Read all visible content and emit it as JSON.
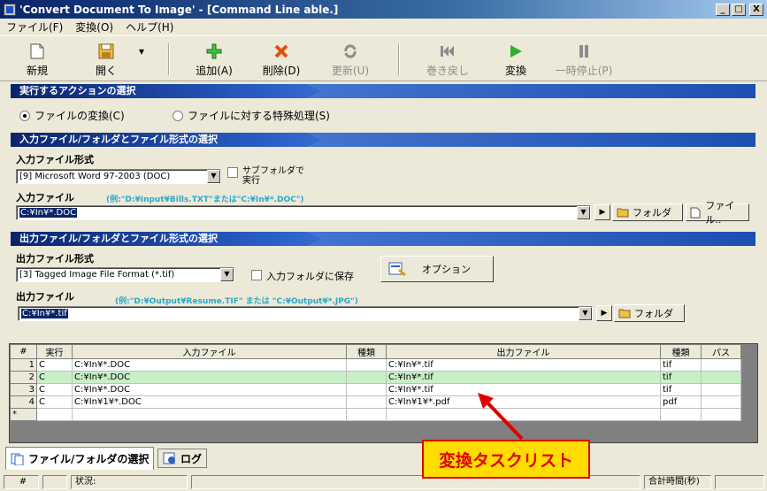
{
  "window": {
    "title": "'Convert Document To Image' - [Command Line able.]",
    "min": "_",
    "max": "□",
    "close": "X"
  },
  "menu": [
    "ファイル(F)",
    "変換(O)",
    "ヘルプ(H)"
  ],
  "toolbar": {
    "new": "新規",
    "open": "開く",
    "add": "追加(A)",
    "delete": "削除(D)",
    "update": "更新(U)",
    "rewind": "巻き戻し",
    "convert": "変換",
    "pause": "一時停止(P)"
  },
  "action_section": {
    "title": "実行するアクションの選択",
    "opt_convert": "ファイルの変換(C)",
    "opt_special": "ファイルに対する特殊処理(S)"
  },
  "input_section": {
    "title": "入力ファイル/フォルダとファイル形式の選択",
    "format_label": "入力ファイル形式",
    "format_value": "[9] Microsoft Word 97-2003 (DOC)",
    "subfolder_label": "サブフォルダで実行",
    "file_label": "入力ファイル",
    "file_hint": "(例:\"D:¥Input¥Bills.TXT\"または\"C:¥In¥*.DOC\")",
    "file_value": "C:¥In¥*.DOC",
    "folder_btn": "フォルダ",
    "file_btn": "ファイル.."
  },
  "output_section": {
    "title": "出力ファイル/フォルダとファイル形式の選択",
    "format_label": "出力ファイル形式",
    "format_value": "[3] Tagged Image File Format (*.tif)",
    "save_input_label": "入力フォルダに保存",
    "options_btn": "オプション",
    "file_label": "出力ファイル",
    "file_hint": "(例:\"D:¥Output¥Resume.TIF\" または \"C:¥Output¥*.JPG\")",
    "file_value": "C:¥In¥*.tif",
    "folder_btn": "フォルダ"
  },
  "grid": {
    "headers": [
      "#",
      "実行",
      "入力ファイル",
      "種類",
      "出力ファイル",
      "種類",
      "パス"
    ],
    "rows": [
      [
        "1",
        "C",
        "C:¥In¥*.DOC",
        "",
        "C:¥In¥*.tif",
        "tif",
        ""
      ],
      [
        "2",
        "C",
        "C:¥In¥*.DOC",
        "",
        "C:¥In¥*.tif",
        "tif",
        ""
      ],
      [
        "3",
        "C",
        "C:¥In¥*.DOC",
        "",
        "C:¥In¥*.tif",
        "tif",
        ""
      ],
      [
        "4",
        "C",
        "C:¥In¥1¥*.DOC",
        "",
        "C:¥In¥1¥*.pdf",
        "pdf",
        ""
      ],
      [
        "*",
        "",
        "",
        "",
        "",
        "",
        ""
      ]
    ]
  },
  "tabs": {
    "files": "ファイル/フォルダの選択",
    "log": "ログ"
  },
  "status": {
    "hash": "#",
    "state": "状況:",
    "total": "合計時間(秒)"
  },
  "annotation": "変換タスクリスト",
  "colors": {
    "highlight_row": "#c8f0c8",
    "annotation_bg": "#ffdd00",
    "annotation_border": "#e00000"
  }
}
